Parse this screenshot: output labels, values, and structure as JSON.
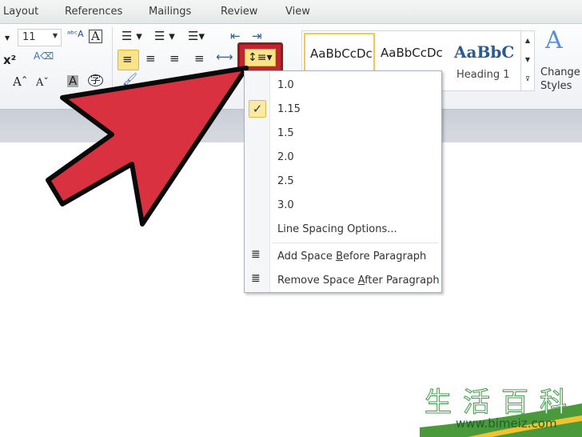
{
  "tabs": [
    "Layout",
    "References",
    "Mailings",
    "Review",
    "View"
  ],
  "font": {
    "size": "11"
  },
  "styles": {
    "items": [
      "AaBbCcDc",
      "AaBbCcDc",
      "AaBbC"
    ],
    "heading_label": "Heading 1",
    "change_styles": [
      "Change",
      "Styles"
    ]
  },
  "menu": {
    "items": [
      "1.0",
      "1.15",
      "1.5",
      "2.0",
      "2.5",
      "3.0"
    ],
    "checked": "1.15",
    "options": "Line Spacing Options...",
    "add_before": {
      "pre": "Add Space ",
      "key": "B",
      "post": "efore Paragraph"
    },
    "remove_after": {
      "pre": "Remove Space ",
      "key": "A",
      "post": "fter Paragraph"
    }
  },
  "watermark": {
    "cn": "生活百科",
    "url": "www.bimeiz.com"
  },
  "colors": {
    "arrow": "#d9313f",
    "highlight": "#fbe38c",
    "red_frame": "#c0262f"
  }
}
